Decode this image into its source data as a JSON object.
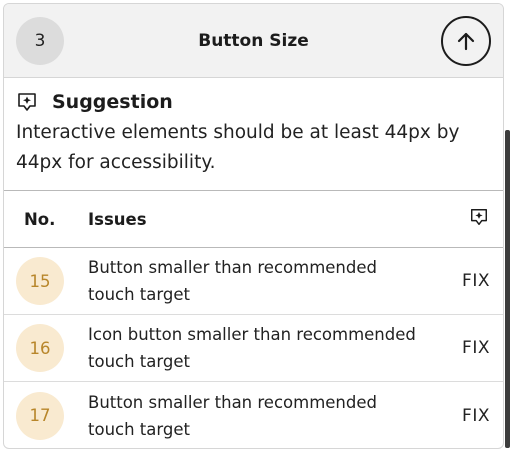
{
  "header": {
    "count": "3",
    "title": "Button Size",
    "collapse_icon": "arrow-up-circle-icon"
  },
  "suggestion": {
    "icon": "sparkle-badge-icon",
    "title": "Suggestion",
    "text": "Interactive elements should be at least 44px by 44px for accessibility."
  },
  "table": {
    "headers": {
      "no": "No.",
      "issues": "Issues",
      "action_icon": "sparkle-badge-icon"
    },
    "rows": [
      {
        "no": "15",
        "issue": "Button smaller than recommended touch target",
        "action": "FIX"
      },
      {
        "no": "16",
        "issue": "Icon button smaller than recommended touch target",
        "action": "FIX"
      },
      {
        "no": "17",
        "issue": "Button smaller than recommended touch target",
        "action": "FIX"
      }
    ]
  },
  "colors": {
    "header_bg": "#f2f2f2",
    "count_badge_bg": "#dcdcdc",
    "row_badge_bg": "#f9ead0",
    "row_badge_text": "#b8862a"
  }
}
